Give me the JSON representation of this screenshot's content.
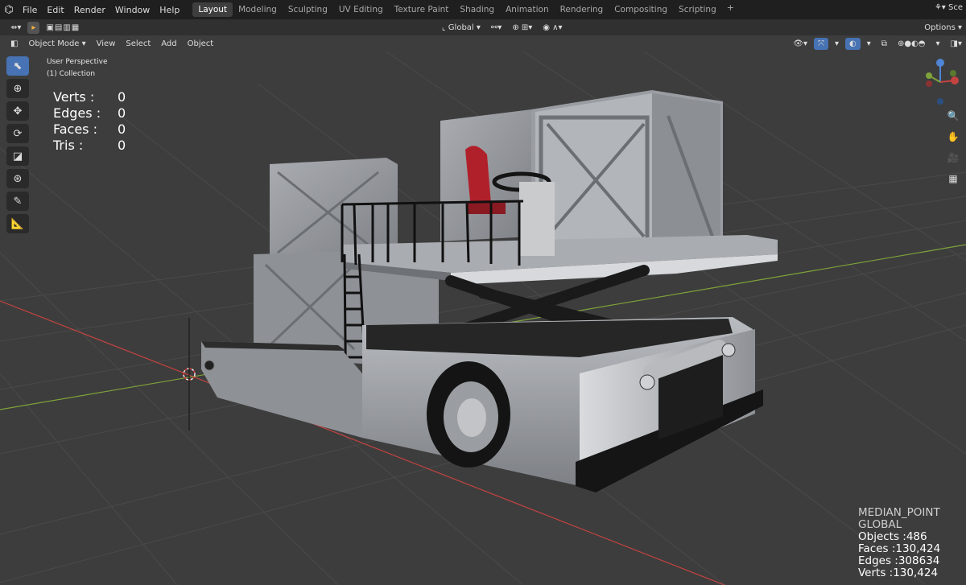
{
  "menu": {
    "logo": "⌬",
    "items": [
      "File",
      "Edit",
      "Render",
      "Window",
      "Help"
    ]
  },
  "workspaces": [
    "Layout",
    "Modeling",
    "Sculpting",
    "UV Editing",
    "Texture Paint",
    "Shading",
    "Animation",
    "Rendering",
    "Compositing",
    "Scripting"
  ],
  "workspace_add": "+",
  "top_right": "Sce",
  "header": {
    "mode": "Object Mode",
    "view": "View",
    "select": "Select",
    "add": "Add",
    "object": "Object",
    "orientation": "Global",
    "options": "Options"
  },
  "viewport_overlay": {
    "perspective": "User Perspective",
    "collection": "(1) Collection"
  },
  "stats": [
    {
      "label": "Verts :",
      "value": "0"
    },
    {
      "label": "Edges :",
      "value": "0"
    },
    {
      "label": "Faces :",
      "value": "0"
    },
    {
      "label": "Tris :",
      "value": "0"
    }
  ],
  "scene_stats": {
    "pivot": "MEDIAN_POINT",
    "space": "GLOBAL",
    "objects": "Objects :486",
    "faces": "Faces :130,424",
    "edges": "Edges :308634",
    "verts": "Verts :130,424"
  },
  "colors": {
    "accent": "#4772b3",
    "axis_x": "#c2433f",
    "axis_y": "#7fa33a",
    "seat": "#b0202a"
  }
}
